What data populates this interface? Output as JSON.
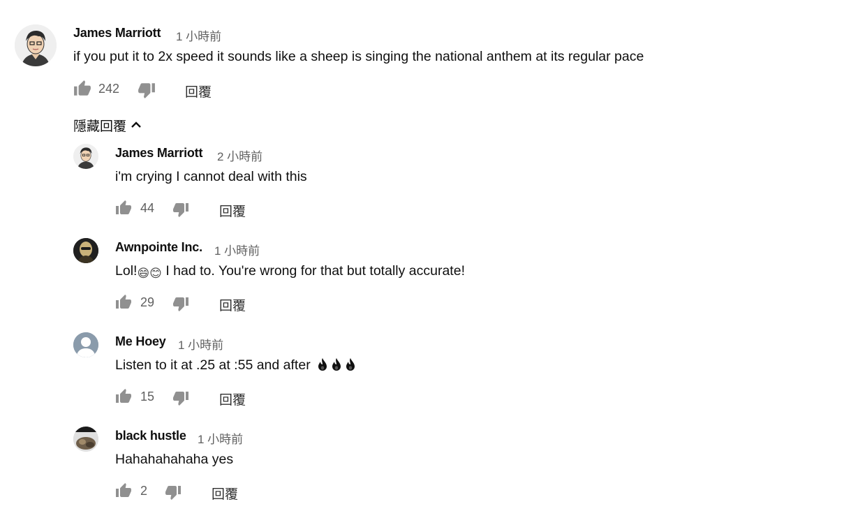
{
  "top_comment": {
    "author": "James Marriott",
    "time": "1 小時前",
    "text": "if you put it to 2x speed it sounds like a sheep is singing the national anthem at its regular pace",
    "likes": "242",
    "reply_label": "回覆",
    "avatar_icon": "cartoon-face-avatar"
  },
  "replies_toggle": {
    "label": "隱藏回覆",
    "icon": "chevron-up-icon"
  },
  "replies": [
    {
      "author": "James Marriott",
      "time": "2 小時前",
      "text": "i'm crying I cannot deal with this",
      "likes": "44",
      "reply_label": "回覆"
    },
    {
      "author": "Awnpointe Inc.",
      "time": "1 小時前",
      "text_before": "Lol!",
      "emoji": "😄😊",
      "text_after": " I had to. You're wrong for that but totally accurate!",
      "likes": "29",
      "reply_label": "回覆"
    },
    {
      "author": "Me Hoey",
      "time": "1 小時前",
      "text": "Listen to it at .25 at :55 and after",
      "emoji_icons": [
        "fire-icon",
        "fire-icon",
        "fire-icon"
      ],
      "likes": "15",
      "reply_label": "回覆"
    },
    {
      "author": "black hustle",
      "time": "1 小時前",
      "text": "Hahahahahaha yes",
      "likes": "2",
      "reply_label": "回覆"
    }
  ],
  "colors": {
    "text": "#0f0f0f",
    "secondary": "#606060",
    "icon": "#909090",
    "default_avatar": "#8a9bab"
  }
}
